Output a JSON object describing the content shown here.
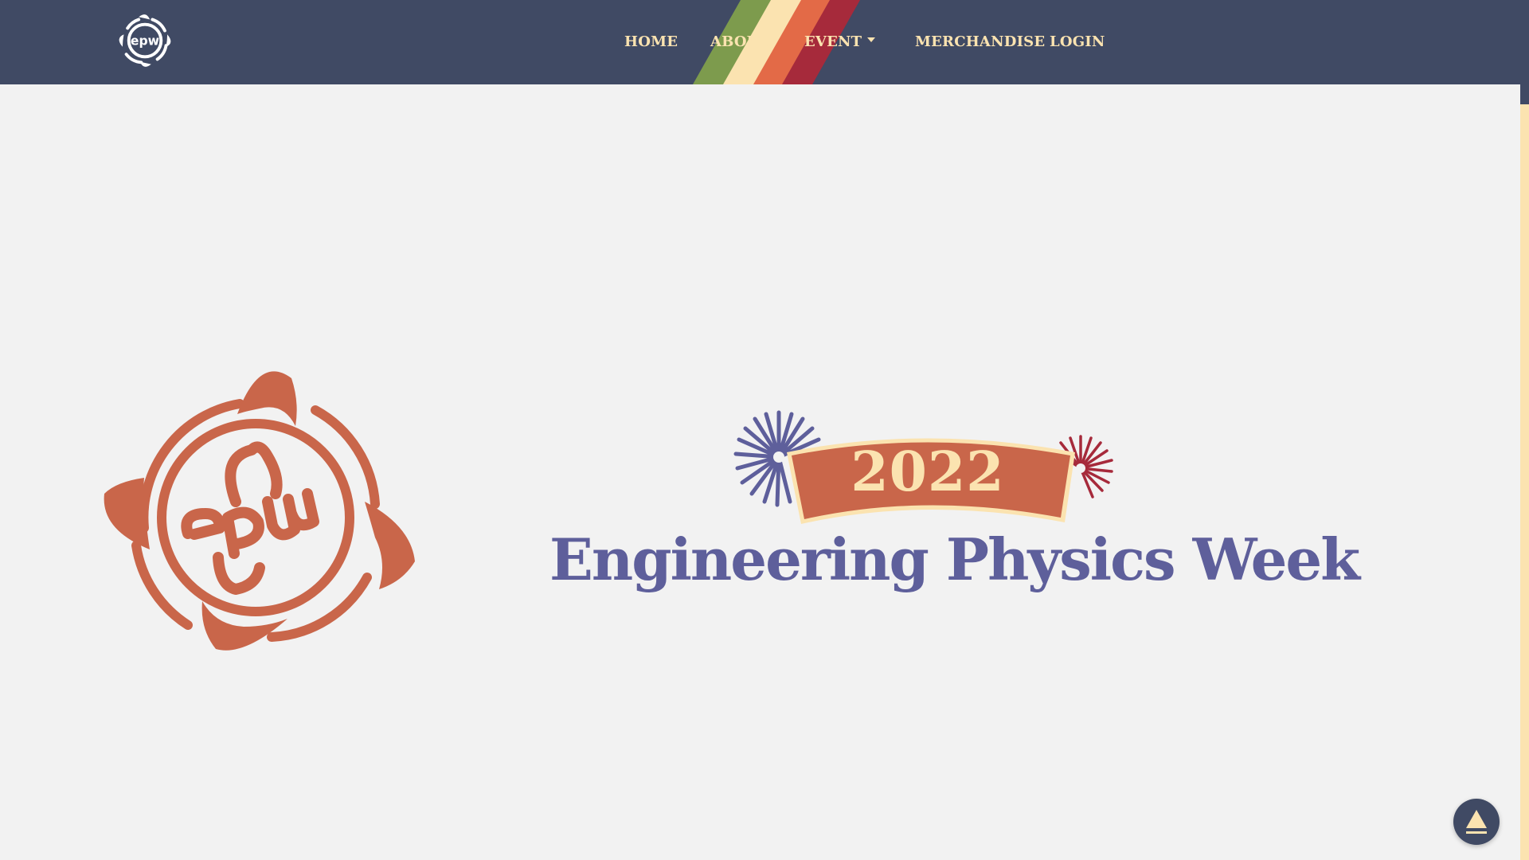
{
  "nav": {
    "items": [
      {
        "label": "HOME"
      },
      {
        "label": "ABOUT"
      },
      {
        "label": "EVENT",
        "has_dropdown": true
      },
      {
        "label": "MERCHANDISE"
      },
      {
        "label": "LOGIN"
      }
    ]
  },
  "hero": {
    "year": "2022",
    "title": "Engineering Physics Week"
  },
  "logo": {
    "icon": "epw-logo",
    "text": "EPW"
  },
  "colors": {
    "navbar": "#404a64",
    "nav_text": "#fbe3b0",
    "stripe_green": "#7d9b4d",
    "stripe_cream": "#fbe3b0",
    "stripe_orange": "#e36a47",
    "stripe_red": "#a62a3b",
    "logo_orange": "#c9664a",
    "title_purple": "#5e5f9b",
    "background": "#f2f2f2"
  },
  "scroll_to_top": {
    "icon": "arrow-up-icon"
  }
}
